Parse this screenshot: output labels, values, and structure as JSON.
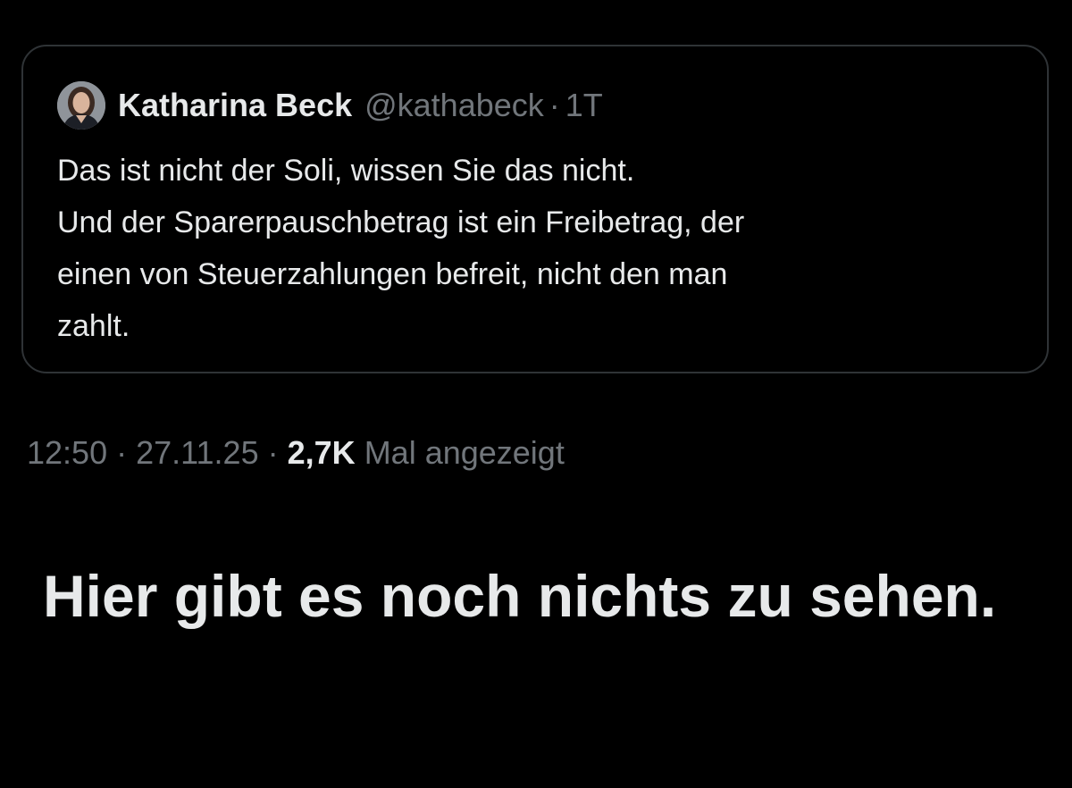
{
  "quoted_post": {
    "author_name": "Katharina Beck",
    "author_handle": "@kathabeck",
    "separator": "·",
    "age": "1T",
    "text_lines": [
      "Das ist nicht der Soli, wissen Sie das nicht.",
      "Und der Sparerpauschbetrag ist ein Freibetrag, der",
      "einen von Steuerzahlungen befreit, nicht den man",
      "zahlt."
    ]
  },
  "post_meta": {
    "time": "12:50",
    "separator": "·",
    "date": "27.11.25",
    "views_count": "2,7K",
    "views_label": "Mal angezeigt"
  },
  "empty_state": {
    "title": "Hier gibt es noch nichts zu sehen."
  },
  "colors": {
    "background": "#000000",
    "primary_text": "#e7e9ea",
    "secondary_text": "#71767b",
    "border": "#2f3336"
  }
}
